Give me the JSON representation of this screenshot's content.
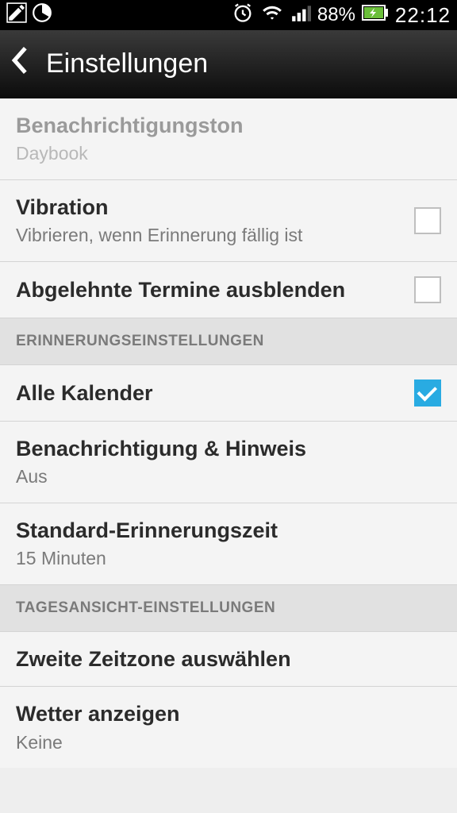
{
  "status": {
    "battery_pct": "88%",
    "time": "22:12"
  },
  "header": {
    "title": "Einstellungen"
  },
  "rows": {
    "notif_sound": {
      "title": "Benachrichtigungston",
      "sub": "Daybook"
    },
    "vibration": {
      "title": "Vibration",
      "sub": "Vibrieren, wenn Erinnerung fällig ist"
    },
    "hide_declined": {
      "title": "Abgelehnte Termine ausblenden"
    },
    "all_calendars": {
      "title": "Alle Kalender"
    },
    "notif_hint": {
      "title": "Benachrichtigung & Hinweis",
      "sub": "Aus"
    },
    "default_reminder": {
      "title": "Standard-Erinnerungszeit",
      "sub": "15 Minuten"
    },
    "second_tz": {
      "title": "Zweite Zeitzone auswählen"
    },
    "show_weather": {
      "title": "Wetter anzeigen",
      "sub": "Keine"
    }
  },
  "sections": {
    "reminder": "ERINNERUNGSEINSTELLUNGEN",
    "dayview": "TAGESANSICHT-EINSTELLUNGEN"
  }
}
